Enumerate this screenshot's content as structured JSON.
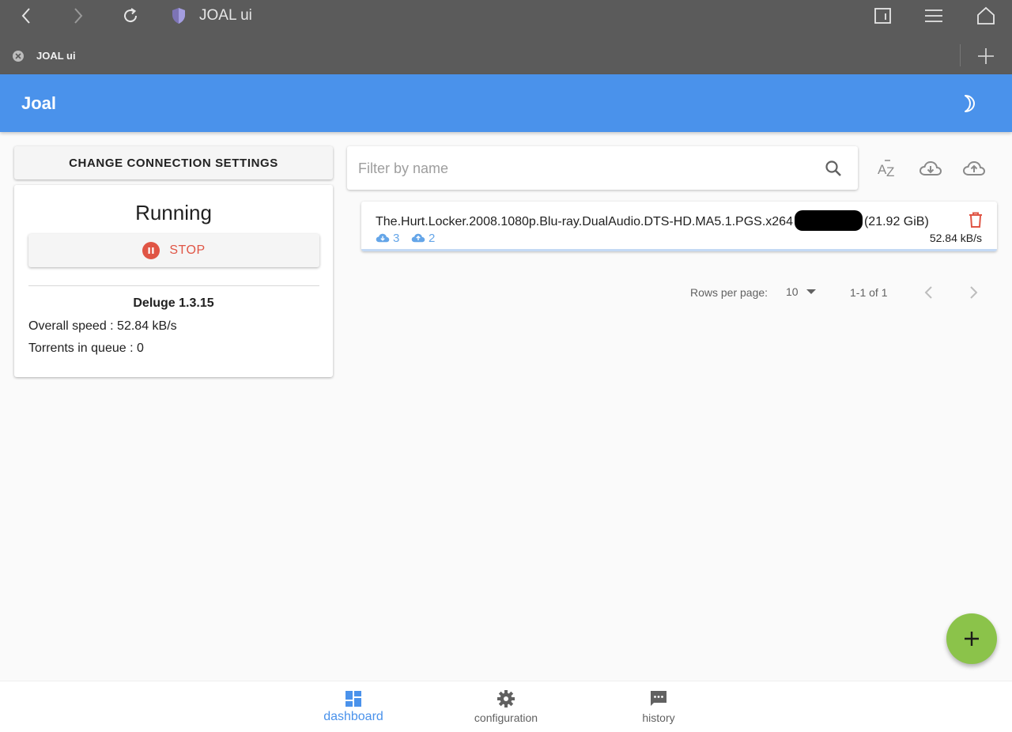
{
  "browser": {
    "page_title": "JOAL ui",
    "tab_title": "JOAL ui",
    "icons": [
      "back-icon",
      "forward-icon",
      "reload-icon",
      "shield-icon",
      "tabs-icon",
      "menu-icon",
      "home-icon",
      "close-icon",
      "plus-icon"
    ]
  },
  "appbar": {
    "title": "Joal",
    "theme_icon": "moon-icon",
    "color": "#4a92eb"
  },
  "left": {
    "connection_button": "CHANGE CONNECTION SETTINGS",
    "status": "Running",
    "stop_label": "STOP",
    "client": "Deluge 1.3.15",
    "overall_speed": "Overall speed : 52.84 kB/s",
    "queue": "Torrents in queue : 0",
    "stop_color": "#e05545"
  },
  "right": {
    "search_placeholder": "Filter by name",
    "tool_icons": [
      "sort-az-icon",
      "cloud-download-icon",
      "cloud-upload-icon"
    ],
    "torrents": [
      {
        "name_before": "The.Hurt.Locker.2008.1080p.Blu-ray.DualAudio.DTS-HD.MA5.1.PGS.x264",
        "name_after": "(21.92 GiB)",
        "leechers": "3",
        "seeders": "2",
        "speed": "52.84 kB/s"
      }
    ],
    "pagination": {
      "rows_label": "Rows per page:",
      "rows_value": "10",
      "range": "1-1 of 1"
    }
  },
  "fab": {
    "icon": "plus-icon",
    "color": "#8bc34a"
  },
  "bottom_nav": {
    "items": [
      {
        "label": "dashboard",
        "icon": "dashboard-icon",
        "active": true
      },
      {
        "label": "configuration",
        "icon": "gear-icon",
        "active": false
      },
      {
        "label": "history",
        "icon": "chat-icon",
        "active": false
      }
    ]
  }
}
